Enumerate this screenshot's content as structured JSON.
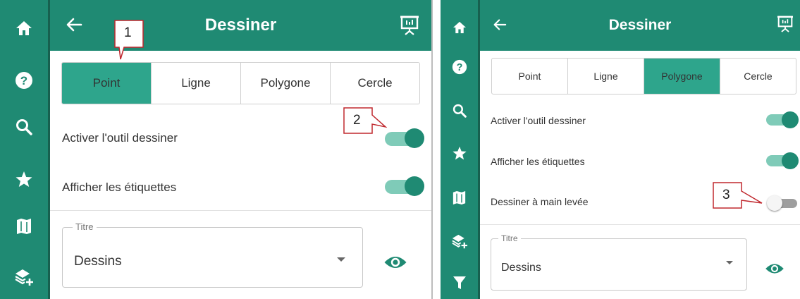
{
  "colors": {
    "primary": "#1f8a73",
    "active_segment": "#2ea58c",
    "callout_border": "#c0282e",
    "toggle_on_track": "#7fcbb8",
    "toggle_off_track": "#9e9e9e"
  },
  "panel_a": {
    "rail_icons": [
      "home-icon",
      "help-icon",
      "search-icon",
      "star-icon",
      "map-icon",
      "add-layer-icon"
    ],
    "header": {
      "title": "Dessiner",
      "back_icon": "arrow-left-icon",
      "present_icon": "presentation-icon"
    },
    "tabs": [
      {
        "label": "Point",
        "active": true
      },
      {
        "label": "Ligne",
        "active": false
      },
      {
        "label": "Polygone",
        "active": false
      },
      {
        "label": "Cercle",
        "active": false
      }
    ],
    "toggles": [
      {
        "label": "Activer l'outil dessiner",
        "on": true
      },
      {
        "label": "Afficher les étiquettes",
        "on": true
      }
    ],
    "select": {
      "legend": "Titre",
      "value": "Dessins"
    },
    "visibility_icon": "eye-icon",
    "callouts": [
      "1",
      "2"
    ]
  },
  "panel_b": {
    "rail_icons": [
      "home-icon",
      "help-icon",
      "search-icon",
      "star-icon",
      "map-icon",
      "add-layer-icon",
      "filter-icon"
    ],
    "header": {
      "title": "Dessiner",
      "back_icon": "arrow-left-icon",
      "present_icon": "presentation-icon"
    },
    "tabs": [
      {
        "label": "Point",
        "active": false
      },
      {
        "label": "Ligne",
        "active": false
      },
      {
        "label": "Polygone",
        "active": true
      },
      {
        "label": "Cercle",
        "active": false
      }
    ],
    "toggles": [
      {
        "label": "Activer l'outil dessiner",
        "on": true
      },
      {
        "label": "Afficher les étiquettes",
        "on": true
      },
      {
        "label": "Dessiner à main levée",
        "on": false
      }
    ],
    "select": {
      "legend": "Titre",
      "value": "Dessins"
    },
    "visibility_icon": "eye-icon",
    "callouts": [
      "3"
    ]
  }
}
